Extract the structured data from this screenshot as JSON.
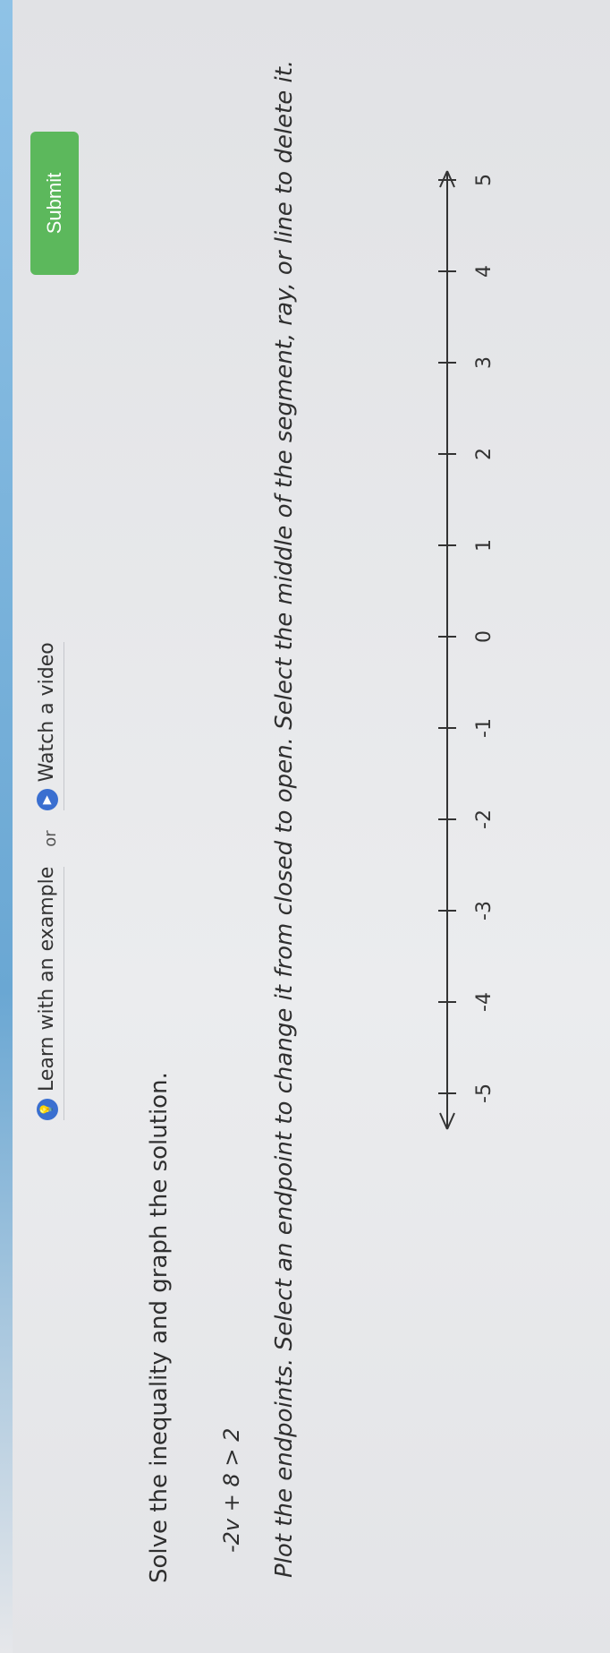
{
  "links": {
    "learn_label": "Learn with an example",
    "or_label": "or",
    "video_label": "Watch a video",
    "learn_icon": "lightbulb-icon",
    "video_icon": "play-icon",
    "accent": "#3a6fd0"
  },
  "question": {
    "prompt": "Solve the inequality and graph the solution.",
    "inequality": "-2v + 8 > 2",
    "instructions": "Plot the endpoints. Select an endpoint to change it from closed to open. Select the middle of the segment, ray, or line to delete it."
  },
  "number_line": {
    "ticks": [
      "-5",
      "-4",
      "-3",
      "-2",
      "-1",
      "0",
      "1",
      "2",
      "3",
      "4",
      "5"
    ]
  },
  "submit": {
    "label": "Submit",
    "color": "#5cb85c"
  }
}
